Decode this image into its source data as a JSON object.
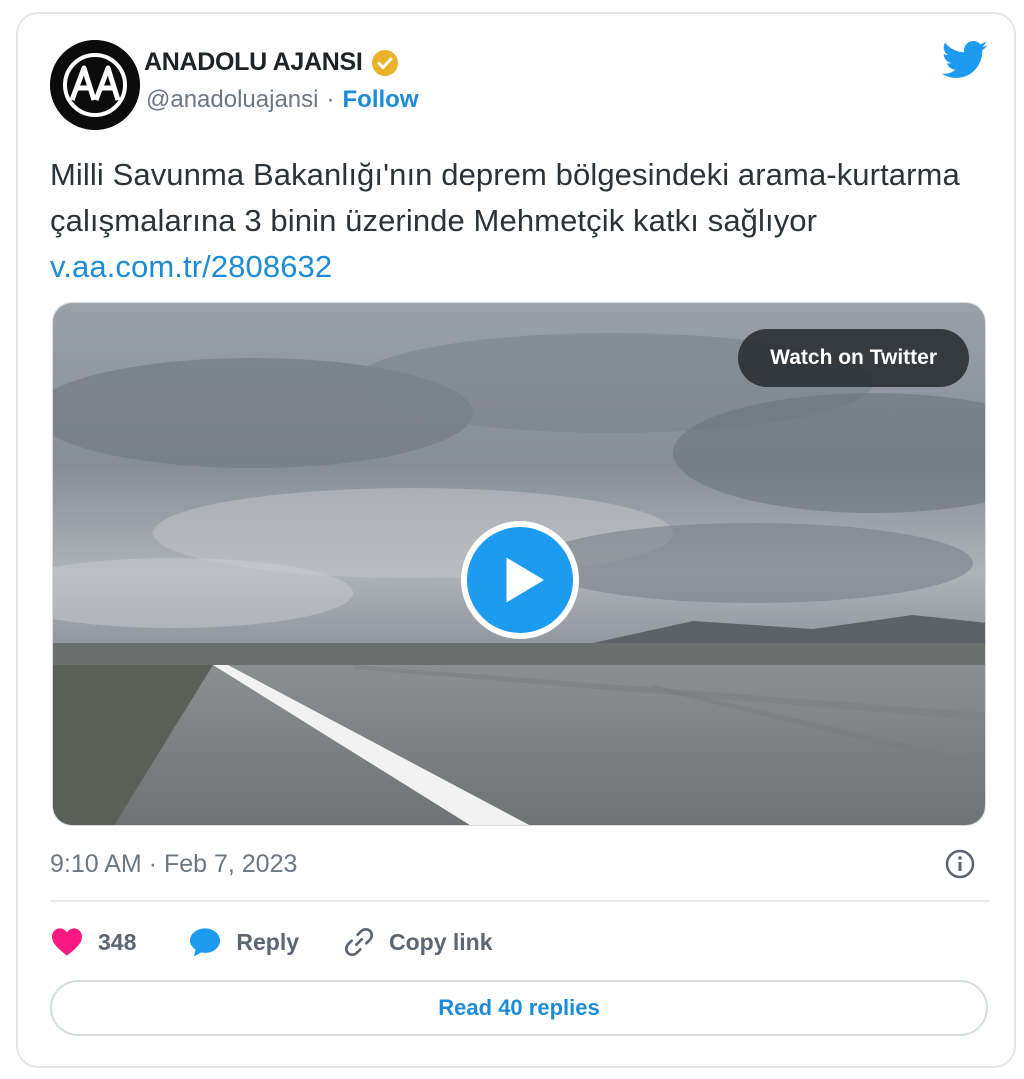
{
  "author": {
    "display_name": "ANADOLU AJANSI",
    "handle": "@anadoluajansi",
    "separator": "·",
    "follow_label": "Follow",
    "logo_text": "AA"
  },
  "tweet": {
    "text": "Milli Savunma Bakanlığı'nın deprem bölgesindeki arama-kurtarma çalışmalarına 3 binin üzerinde Mehmetçik katkı sağlıyor ",
    "link": "v.aa.com.tr/2808632",
    "timestamp": "9:10 AM · Feb 7, 2023"
  },
  "media": {
    "watch_label": "Watch on Twitter"
  },
  "actions": {
    "likes": "348",
    "reply_label": "Reply",
    "copy_label": "Copy link"
  },
  "read_replies_label": "Read 40 replies",
  "colors": {
    "accent": "#1d9bf0",
    "link": "#1d8cd8",
    "like": "#f91880",
    "verified": "#e8b22a"
  },
  "icons": [
    "twitter-bird-icon",
    "verified-badge-icon",
    "play-icon",
    "info-icon",
    "heart-icon",
    "reply-bubble-icon",
    "link-icon"
  ]
}
